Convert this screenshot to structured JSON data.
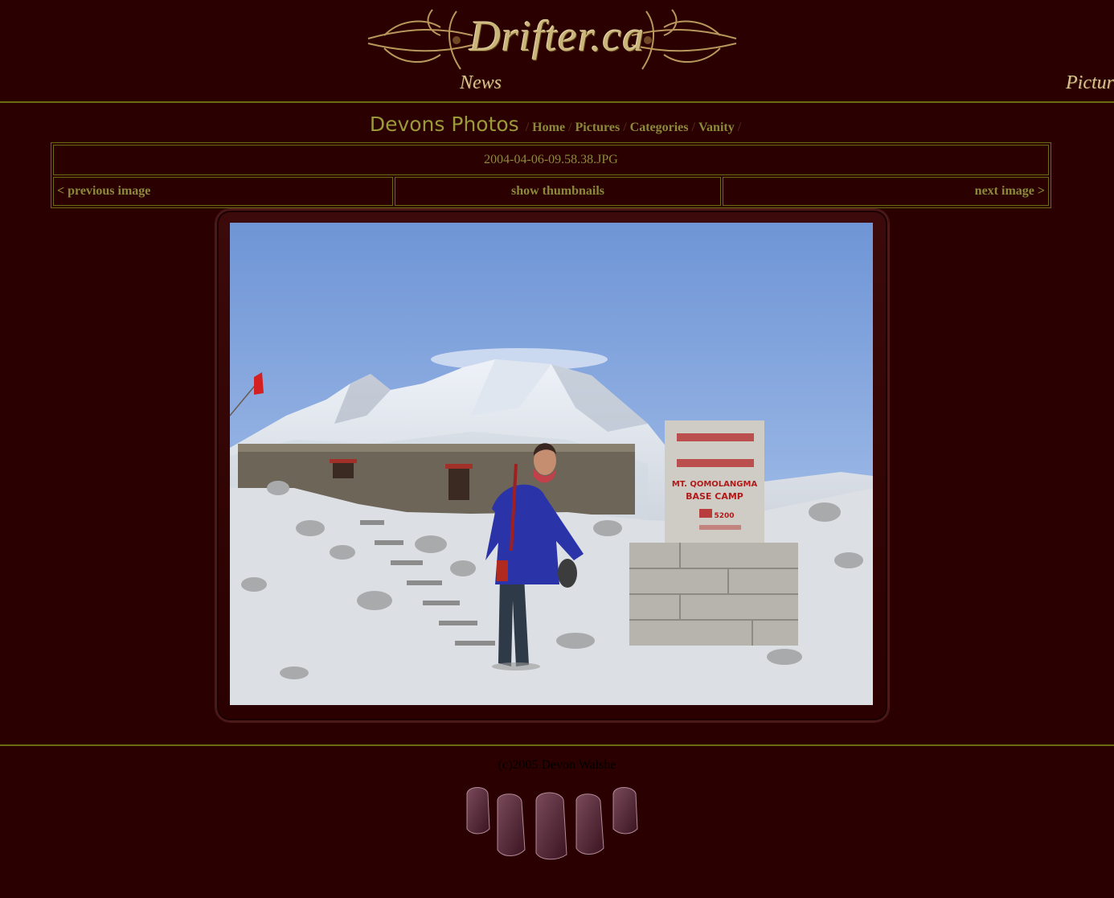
{
  "header": {
    "logo_text": "Drifter.ca",
    "nav": {
      "news": "News",
      "pictures": "Pictures"
    }
  },
  "titlebar": {
    "site_title": "Devons Photos",
    "separator": "/",
    "crumbs": [
      "Home",
      "Pictures",
      "Categories",
      "Vanity"
    ]
  },
  "image_nav": {
    "filename": "2004-04-06-09.58.38.JPG",
    "prev_arrow": "<",
    "prev_label": "previous image",
    "thumbs_label": "show thumbnails",
    "next_label": "next image",
    "next_arrow": ">"
  },
  "photo": {
    "sign_lines": [
      "MT. QOMOLANGMA",
      "BASE CAMP",
      "5200"
    ]
  },
  "footer": {
    "copyright": "(c)2005 Devon Walshe"
  },
  "colors": {
    "background": "#2b0000",
    "link": "#8a8a3a",
    "rule": "#6b6b14"
  }
}
